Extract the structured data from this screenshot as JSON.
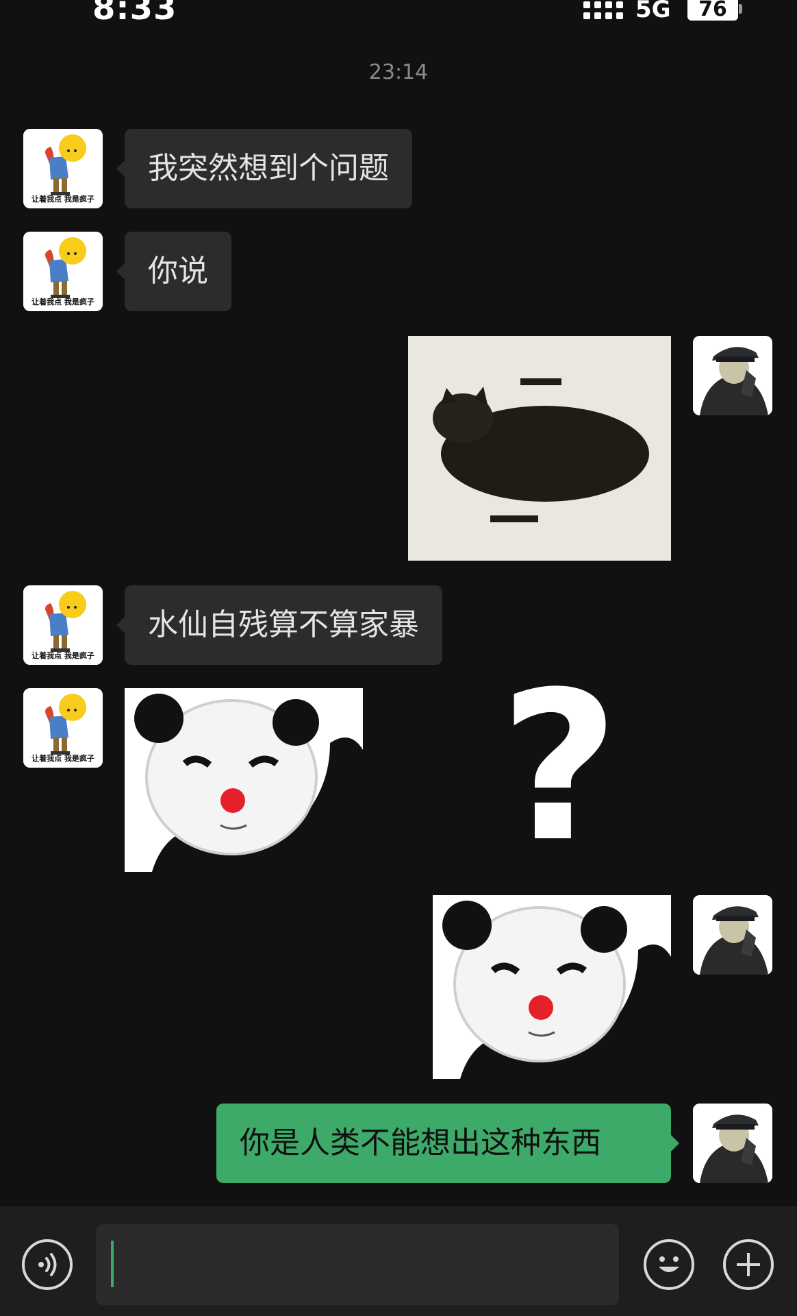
{
  "status_bar": {
    "time": "8:33",
    "network": "5G",
    "battery": "76"
  },
  "chat": {
    "timestamp": "23:14",
    "avatar_left_caption": "让着我点 我是疯子",
    "messages": [
      {
        "side": "in",
        "kind": "text",
        "text": "我突然想到个问题"
      },
      {
        "side": "in",
        "kind": "text",
        "text": "你说"
      },
      {
        "side": "out",
        "kind": "image",
        "image": "black-cat-photo"
      },
      {
        "side": "in",
        "kind": "text",
        "text": "水仙自残算不算家暴"
      },
      {
        "side": "in",
        "kind": "sticker",
        "image": "panda-clown-sticker"
      },
      {
        "side": "out",
        "kind": "sticker",
        "image": "panda-clown-sticker"
      },
      {
        "side": "out",
        "kind": "text",
        "text": "你是人类不能想出这种东西"
      }
    ],
    "question_mark": "?"
  },
  "input_bar": {
    "voice_icon": "voice-icon",
    "emoji_icon": "emoji-icon",
    "more_icon": "plus-icon",
    "value": ""
  },
  "colors": {
    "background": "#111111",
    "incoming_bubble": "#2c2c2c",
    "outgoing_bubble": "#3daa6a",
    "text": "#e4e4e4"
  }
}
